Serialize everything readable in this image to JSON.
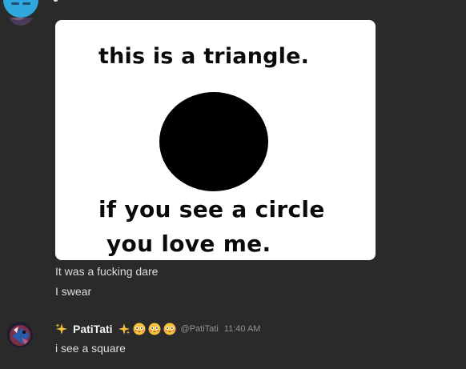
{
  "attachment": {
    "line1": "this is a triangle.",
    "line2": "if you see a circle",
    "line3": "you love me."
  },
  "messages": [
    {
      "text": "It was a fucking dare"
    },
    {
      "text": "I swear"
    }
  ],
  "reply": {
    "username": "PatiTati",
    "handle": "@PatiTati",
    "timestamp": "11:40 AM",
    "text": "i see a square",
    "emojis": [
      "sparkles",
      "sparkles",
      "flushed-face",
      "flushed-face",
      "flushed-face"
    ]
  }
}
